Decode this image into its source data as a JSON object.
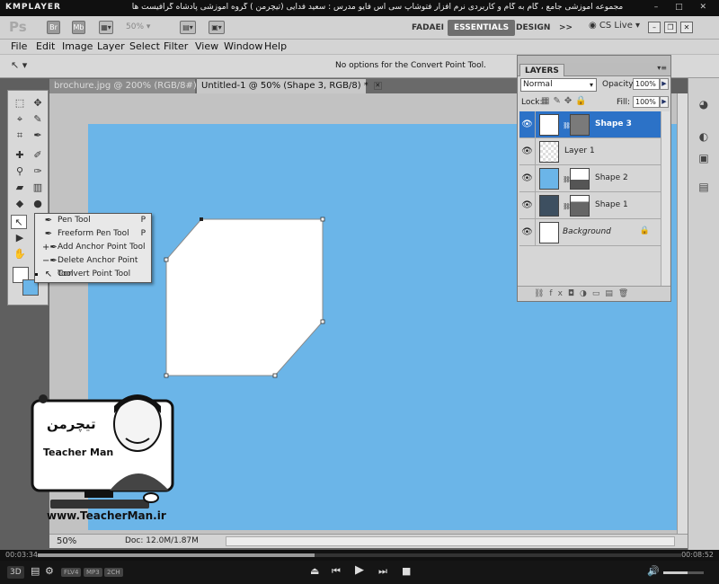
{
  "player": {
    "logo": "KMPLAYER",
    "title": "مجموعه آموزشی جامع ، گام به گام و کاربردی نرم افزار فتوشاپ سی اس فایو مدرس : سعید فدایی (تیچرمن ) گروه آموزشی پادشاه گرافیست ها",
    "time_elapsed": "00:03:34",
    "time_total": "00:08:52",
    "progress": 0.43,
    "volume": 0.6,
    "badges": [
      "FLV4",
      "MP3",
      "2CH"
    ],
    "left_badge": "3D"
  },
  "ps": {
    "logo": "Ps",
    "app_icons": [
      "Br",
      "Mb"
    ],
    "zoom_dropdown": "50%",
    "workspaces": [
      {
        "label": "FADAEI",
        "active": false
      },
      {
        "label": "ESSENTIALS",
        "active": true
      },
      {
        "label": "DESIGN",
        "active": false
      }
    ],
    "more": ">>",
    "cs_live": "CS Live"
  },
  "menu": [
    "File",
    "Edit",
    "Image",
    "Layer",
    "Select",
    "Filter",
    "View",
    "Window",
    "Help"
  ],
  "options_bar": {
    "message": "No options for the Convert Point Tool."
  },
  "doc_tabs": [
    {
      "label": "brochure.jpg @ 200% (RGB/8#)",
      "active": false
    },
    {
      "label": "Untitled-1 @ 50% (Shape 3, RGB/8) *",
      "active": true
    }
  ],
  "status": {
    "zoom": "50%",
    "doc": "Doc: 12.0M/1.87M"
  },
  "flyout": [
    {
      "label": "Pen Tool",
      "key": "P",
      "icon": "pen-icon",
      "current": false
    },
    {
      "label": "Freeform Pen Tool",
      "key": "P",
      "icon": "freeform-pen-icon",
      "current": false
    },
    {
      "label": "Add Anchor Point Tool",
      "key": "",
      "icon": "add-anchor-icon",
      "current": false
    },
    {
      "label": "Delete Anchor Point Tool",
      "key": "",
      "icon": "delete-anchor-icon",
      "current": false
    },
    {
      "label": "Convert Point Tool",
      "key": "",
      "icon": "convert-point-icon",
      "current": true
    }
  ],
  "layers_panel": {
    "tab": "LAYERS",
    "blend_mode": "Normal",
    "opacity_label": "Opacity:",
    "opacity": "100%",
    "lock_label": "Lock:",
    "fill_label": "Fill:",
    "fill": "100%",
    "layers": [
      {
        "name": "Shape 3",
        "selected": true,
        "thumb": "#ffffff",
        "mask": true,
        "italic": false,
        "locked": false
      },
      {
        "name": "Layer 1",
        "selected": false,
        "thumb": "transparent",
        "mask": false,
        "italic": false,
        "locked": false
      },
      {
        "name": "Shape 2",
        "selected": false,
        "thumb": "#6bb5e8",
        "mask": true,
        "italic": false,
        "locked": false
      },
      {
        "name": "Shape 1",
        "selected": false,
        "thumb": "#3d4f60",
        "mask": true,
        "italic": false,
        "locked": false
      },
      {
        "name": "Background",
        "selected": false,
        "thumb": "#ffffff",
        "mask": false,
        "italic": true,
        "locked": true
      }
    ]
  },
  "watermark": {
    "logo_text": "تیچرمن",
    "name": "Teacher Man",
    "url": "www.TeacherMan.ir"
  },
  "colors": {
    "canvas": "#6bb5e8",
    "selection": "#2c72c7"
  }
}
